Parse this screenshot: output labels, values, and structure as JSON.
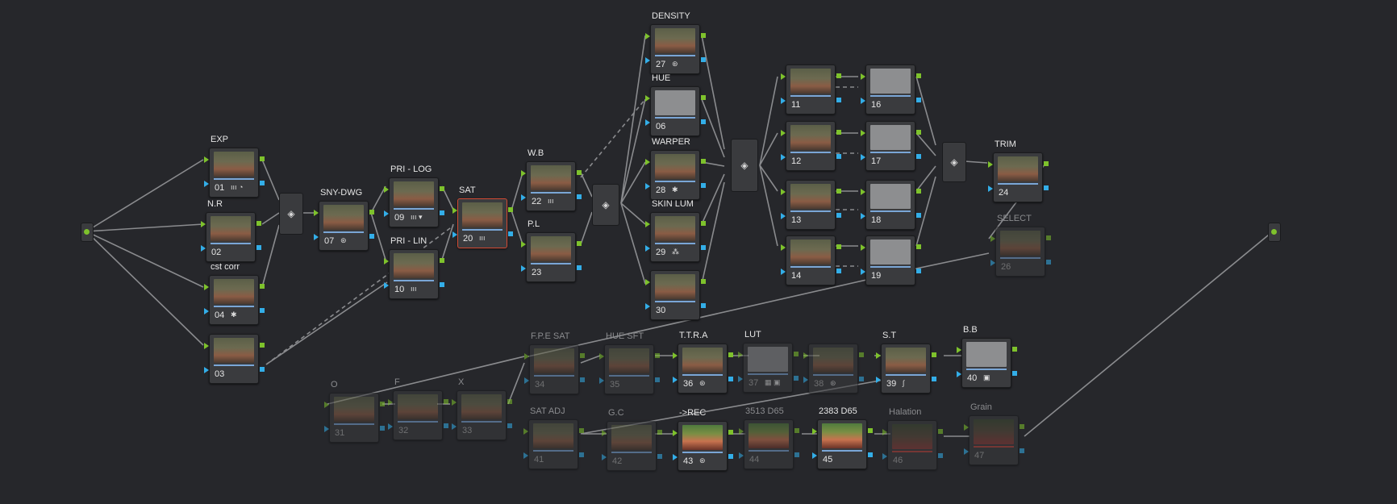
{
  "source_node": {
    "name": "source"
  },
  "output_node": {
    "name": "output"
  },
  "mixers": [
    "layer-mixer"
  ],
  "nodes": [
    {
      "id": "01",
      "label": "EXP",
      "icons": "ııı ◔"
    },
    {
      "id": "02",
      "label": "N.R",
      "icons": ""
    },
    {
      "id": "04",
      "label": "cst corr",
      "icons": "✱"
    },
    {
      "id": "03",
      "label": "",
      "icons": ""
    },
    {
      "id": "07",
      "label": "SNY-DWG",
      "icons": "⊛"
    },
    {
      "id": "09",
      "label": "PRI - LOG",
      "icons": "ııı ▾"
    },
    {
      "id": "10",
      "label": "PRI - LIN",
      "icons": "ııı"
    },
    {
      "id": "20",
      "label": "SAT",
      "icons": "ııı"
    },
    {
      "id": "22",
      "label": "W.B",
      "icons": "ııı"
    },
    {
      "id": "23",
      "label": "P.L",
      "icons": ""
    },
    {
      "id": "27",
      "label": "DENSITY",
      "icons": "⊛"
    },
    {
      "id": "06",
      "label": "HUE",
      "icons": ""
    },
    {
      "id": "28",
      "label": "WARPER",
      "icons": "✱"
    },
    {
      "id": "29",
      "label": "SKIN LUM",
      "icons": "⁂"
    },
    {
      "id": "30",
      "label": "",
      "icons": ""
    },
    {
      "id": "11",
      "label": "",
      "icons": ""
    },
    {
      "id": "12",
      "label": "",
      "icons": ""
    },
    {
      "id": "13",
      "label": "",
      "icons": ""
    },
    {
      "id": "14",
      "label": "",
      "icons": ""
    },
    {
      "id": "16",
      "label": "",
      "icons": ""
    },
    {
      "id": "17",
      "label": "",
      "icons": ""
    },
    {
      "id": "18",
      "label": "",
      "icons": ""
    },
    {
      "id": "19",
      "label": "",
      "icons": ""
    },
    {
      "id": "24",
      "label": "TRIM",
      "icons": ""
    },
    {
      "id": "26",
      "label": "SELECT",
      "icons": ""
    },
    {
      "id": "31",
      "label": "O",
      "icons": ""
    },
    {
      "id": "32",
      "label": "F",
      "icons": ""
    },
    {
      "id": "33",
      "label": "X",
      "icons": ""
    },
    {
      "id": "34",
      "label": "F.P.E SAT",
      "icons": ""
    },
    {
      "id": "35",
      "label": "HUE SFT",
      "icons": ""
    },
    {
      "id": "36",
      "label": "T.T.R.A",
      "icons": "⊛"
    },
    {
      "id": "37",
      "label": "LUT",
      "icons": "▦ ▣"
    },
    {
      "id": "38",
      "label": "",
      "icons": "⊛"
    },
    {
      "id": "39",
      "label": "S.T",
      "icons": "∫"
    },
    {
      "id": "40",
      "label": "B.B",
      "icons": "▣"
    },
    {
      "id": "41",
      "label": "SAT ADJ",
      "icons": ""
    },
    {
      "id": "42",
      "label": "G.C",
      "icons": ""
    },
    {
      "id": "43",
      "label": "->REC",
      "icons": "⊛"
    },
    {
      "id": "44",
      "label": "3513 D65",
      "icons": ""
    },
    {
      "id": "45",
      "label": "2383 D65",
      "icons": ""
    },
    {
      "id": "46",
      "label": "Halation",
      "icons": ""
    },
    {
      "id": "47",
      "label": "Grain",
      "icons": ""
    }
  ]
}
